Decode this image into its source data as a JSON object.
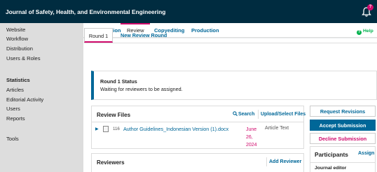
{
  "header": {
    "site_title": "Journal of Safety, Health, and Environmental Engineering",
    "notification_count": "?"
  },
  "sidebar": {
    "items": [
      {
        "label": "Website"
      },
      {
        "label": "Workflow"
      },
      {
        "label": "Distribution"
      },
      {
        "label": "Users & Roles"
      },
      {
        "label": "Statistics"
      },
      {
        "label": "Articles"
      },
      {
        "label": "Editorial Activity"
      },
      {
        "label": "Users"
      },
      {
        "label": "Reports"
      },
      {
        "label": "Tools"
      }
    ]
  },
  "stage_tabs": [
    {
      "label": "Submission"
    },
    {
      "label": "Review"
    },
    {
      "label": "Copyediting"
    },
    {
      "label": "Production"
    }
  ],
  "help_label": "Help",
  "round_tabs": [
    {
      "label": "Round 1"
    },
    {
      "label": "New Review Round"
    }
  ],
  "status": {
    "title": "Round 1 Status",
    "text": "Waiting for reviewers to be assigned."
  },
  "review_files": {
    "title": "Review Files",
    "search_label": "Search",
    "upload_label": "Upload/Select Files",
    "files": [
      {
        "id": "116",
        "name": "Author Guidelines_Indonesian Version (1).docx",
        "date_line1": "June",
        "date_line2": "26,",
        "date_line3": "2024",
        "type": "Article Text"
      }
    ]
  },
  "reviewers": {
    "title": "Reviewers",
    "add_label": "Add Reviewer"
  },
  "actions": {
    "request_revisions": "Request Revisions",
    "accept_submission": "Accept Submission",
    "decline_submission": "Decline Submission"
  },
  "participants": {
    "title": "Participants",
    "assign_label": "Assign",
    "group": "Journal editor"
  },
  "colors": {
    "header": "#002c40",
    "accent": "#006798",
    "highlight": "#d00a6c",
    "help": "#00b24e"
  }
}
